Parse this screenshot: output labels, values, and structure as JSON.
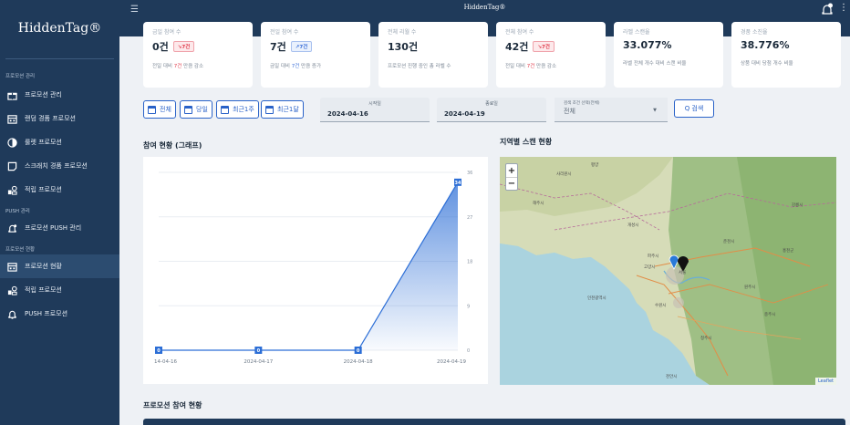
{
  "app": {
    "brand": "HiddenTag®",
    "top_title": "HiddenTag®"
  },
  "sidebar": {
    "sections": [
      {
        "title": "프로모션 관리"
      },
      {
        "title": "PUSH 관리"
      },
      {
        "title": "프로모션 현황"
      }
    ],
    "items": [
      {
        "label": "프로모션 관리",
        "icon": "gift-icon"
      },
      {
        "label": "랜덤 경품 프로모션",
        "icon": "gift-box-icon"
      },
      {
        "label": "룰렛 프로모션",
        "icon": "roulette-icon"
      },
      {
        "label": "스크래치 경품 프로모션",
        "icon": "scratch-card-icon"
      },
      {
        "label": "적립 프로모션",
        "icon": "point-icon"
      },
      {
        "label": "프로모션 PUSH 관리",
        "icon": "bell-icon"
      },
      {
        "label": "프로모션 현황",
        "icon": "gift-box-icon",
        "active": true
      },
      {
        "label": "적립 프로모션",
        "icon": "point-icon"
      },
      {
        "label": "PUSH 프로모션",
        "icon": "bell-icon"
      }
    ]
  },
  "stats": [
    {
      "label": "금일 참여 수",
      "value": "0건",
      "badge": "↘7건",
      "badge_type": "down",
      "sub_pre": "전일 대비 ",
      "sub_hl": "7건",
      "sub_post": " 만큼 감소"
    },
    {
      "label": "전일 참여 수",
      "value": "7건",
      "badge": "↗7건",
      "badge_type": "up",
      "sub_pre": "금일 대비 ",
      "sub_hl": "7건",
      "sub_post": " 만큼 증가"
    },
    {
      "label": "전체 리월 수",
      "value": "130건",
      "badge": "",
      "badge_type": "",
      "sub_pre": "프로모션 진행 중인 총 라벨 수",
      "sub_hl": "",
      "sub_post": ""
    },
    {
      "label": "전체 참여 수",
      "value": "42건",
      "badge": "↘7건",
      "badge_type": "down",
      "sub_pre": "전일 대비 ",
      "sub_hl": "7건",
      "sub_post": " 만큼 감소"
    },
    {
      "label": "라벨 스캔율",
      "value": "33.077%",
      "badge": "",
      "badge_type": "",
      "sub_pre": "라벨 전체 개수 대비 스캔 비율",
      "sub_hl": "",
      "sub_post": ""
    },
    {
      "label": "경품 소진율",
      "value": "38.776%",
      "badge": "",
      "badge_type": "",
      "sub_pre": "상품 대비 당첨 개수 비율",
      "sub_hl": "",
      "sub_post": ""
    }
  ],
  "filters": {
    "buttons": [
      "전체",
      "당일",
      "최근1주",
      "최근1달"
    ],
    "start_label": "시작일",
    "start_value": "2024-04-16",
    "end_label": "종료일",
    "end_value": "2024-04-19",
    "select_label": "검색 조건 선택(전체)",
    "select_value": "전체",
    "search_label": "Q 검색"
  },
  "sections": {
    "chart_title": "참여 현황 (그래프)",
    "map_title": "지역별 스캔 현황",
    "table_title": "프로모션 참여 현황"
  },
  "chart_data": {
    "type": "area",
    "x": [
      "14-04-16",
      "2024-04-17",
      "2024-04-18",
      "2024-04-19"
    ],
    "values": [
      0,
      0,
      0,
      34
    ],
    "y_ticks": [
      0,
      9,
      18,
      27,
      36
    ],
    "ylim": [
      0,
      36
    ],
    "line_color": "#2c6ed6",
    "y_axis_position": "right"
  },
  "map": {
    "zoom_in": "+",
    "zoom_out": "−",
    "attribution": "Leaflet",
    "labels": [
      "평양",
      "사리원시",
      "해주시",
      "개성시",
      "파주시",
      "고양시",
      "서울",
      "인천광역시",
      "수원시",
      "천안시",
      "춘천시",
      "원주시",
      "충주시",
      "청주시",
      "강릉시",
      "홍천군"
    ]
  },
  "colors": {
    "sidebar": "#1f3a5a",
    "accent": "#2962c8",
    "down": "#e03b4b",
    "up": "#3a6fd8"
  }
}
